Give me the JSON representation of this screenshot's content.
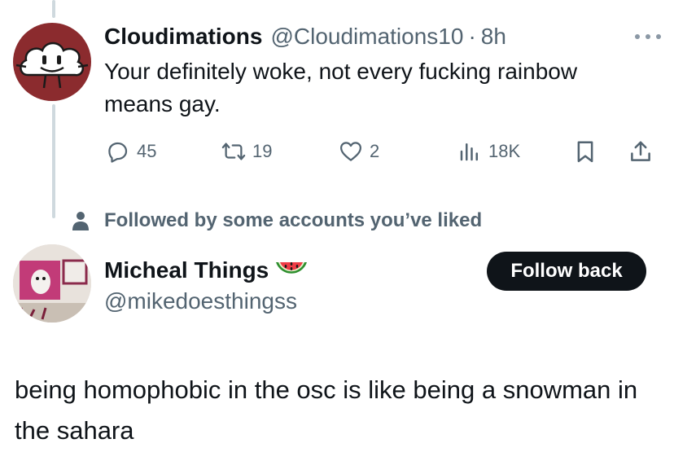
{
  "tweet1": {
    "author_name": "Cloudimations",
    "author_handle": "@Cloudimations10",
    "separator": "·",
    "time": "8h",
    "text": "Your definitely woke, not every fucking rainbow means gay.",
    "stats": {
      "replies": "45",
      "reposts": "19",
      "likes": "2",
      "views": "18K"
    },
    "avatar_icon": "cloud-character-avatar"
  },
  "social_context": {
    "text": "Followed by some accounts you’ve liked",
    "icon": "person-icon"
  },
  "tweet2": {
    "author_name": "Micheal Things",
    "author_handle": "@mikedoesthingss",
    "name_emoji": "watermelon-icon",
    "follow_button_label": "Follow back",
    "text": "being homophobic in the osc is like being a snowman in the sahara"
  },
  "colors": {
    "text_primary": "#0f1419",
    "text_secondary": "#536471",
    "thread_line": "#cfd9de",
    "button_bg": "#0f1419"
  }
}
